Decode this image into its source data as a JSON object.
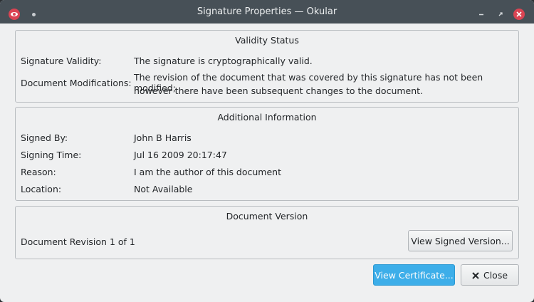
{
  "window": {
    "title": "Signature Properties — Okular"
  },
  "validity": {
    "heading": "Validity Status",
    "rows": [
      {
        "label": "Signature Validity:",
        "value": "The signature is cryptographically valid."
      },
      {
        "label": "Document Modifications:",
        "value_line1": "The revision of the document that was covered by this signature has not been modified;",
        "value_line2": "however there have been subsequent changes to the document."
      }
    ]
  },
  "additional": {
    "heading": "Additional Information",
    "rows": [
      {
        "label": "Signed By:",
        "value": "John B Harris"
      },
      {
        "label": "Signing Time:",
        "value": "Jul 16 2009 20:17:47"
      },
      {
        "label": "Reason:",
        "value": "I am the author of this document"
      },
      {
        "label": "Location:",
        "value": "Not Available"
      }
    ]
  },
  "version": {
    "heading": "Document Version",
    "revision_text": "Document Revision 1 of 1",
    "view_signed_label": "View Signed Version..."
  },
  "footer": {
    "view_certificate_label": "View Certificate...",
    "close_label": "Close"
  },
  "colors": {
    "accent": "#3daee9",
    "close_red": "#da4453",
    "titlebar": "#475057"
  },
  "icons": {
    "app": "okular-eye-icon",
    "close_button_glyph": "close-x-icon"
  }
}
